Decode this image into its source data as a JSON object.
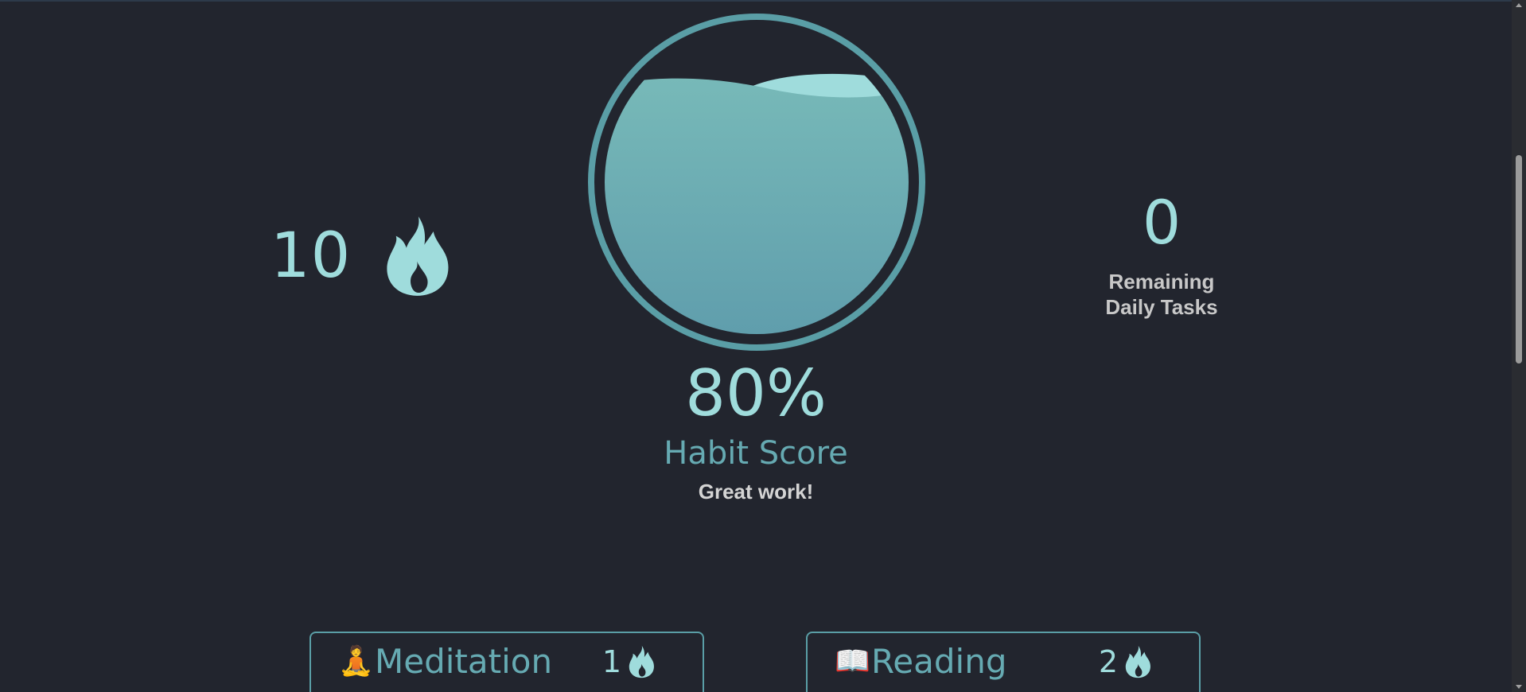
{
  "streak": {
    "count": "10",
    "icon": "flame-icon"
  },
  "score": {
    "value": "80%",
    "percent": 80,
    "label": "Habit Score",
    "message": "Great work!"
  },
  "remaining": {
    "count": "0",
    "label": "Remaining Daily Tasks"
  },
  "habits": [
    {
      "icon": "🧘",
      "name": "Meditation",
      "streak": "1"
    },
    {
      "icon": "📖",
      "name": "Reading",
      "streak": "2"
    }
  ],
  "colors": {
    "background": "#22252e",
    "accent": "#9fdcdc",
    "accent_dark": "#66aab2",
    "ring": "#5a9ea6",
    "text_muted": "#c8c8c8"
  }
}
